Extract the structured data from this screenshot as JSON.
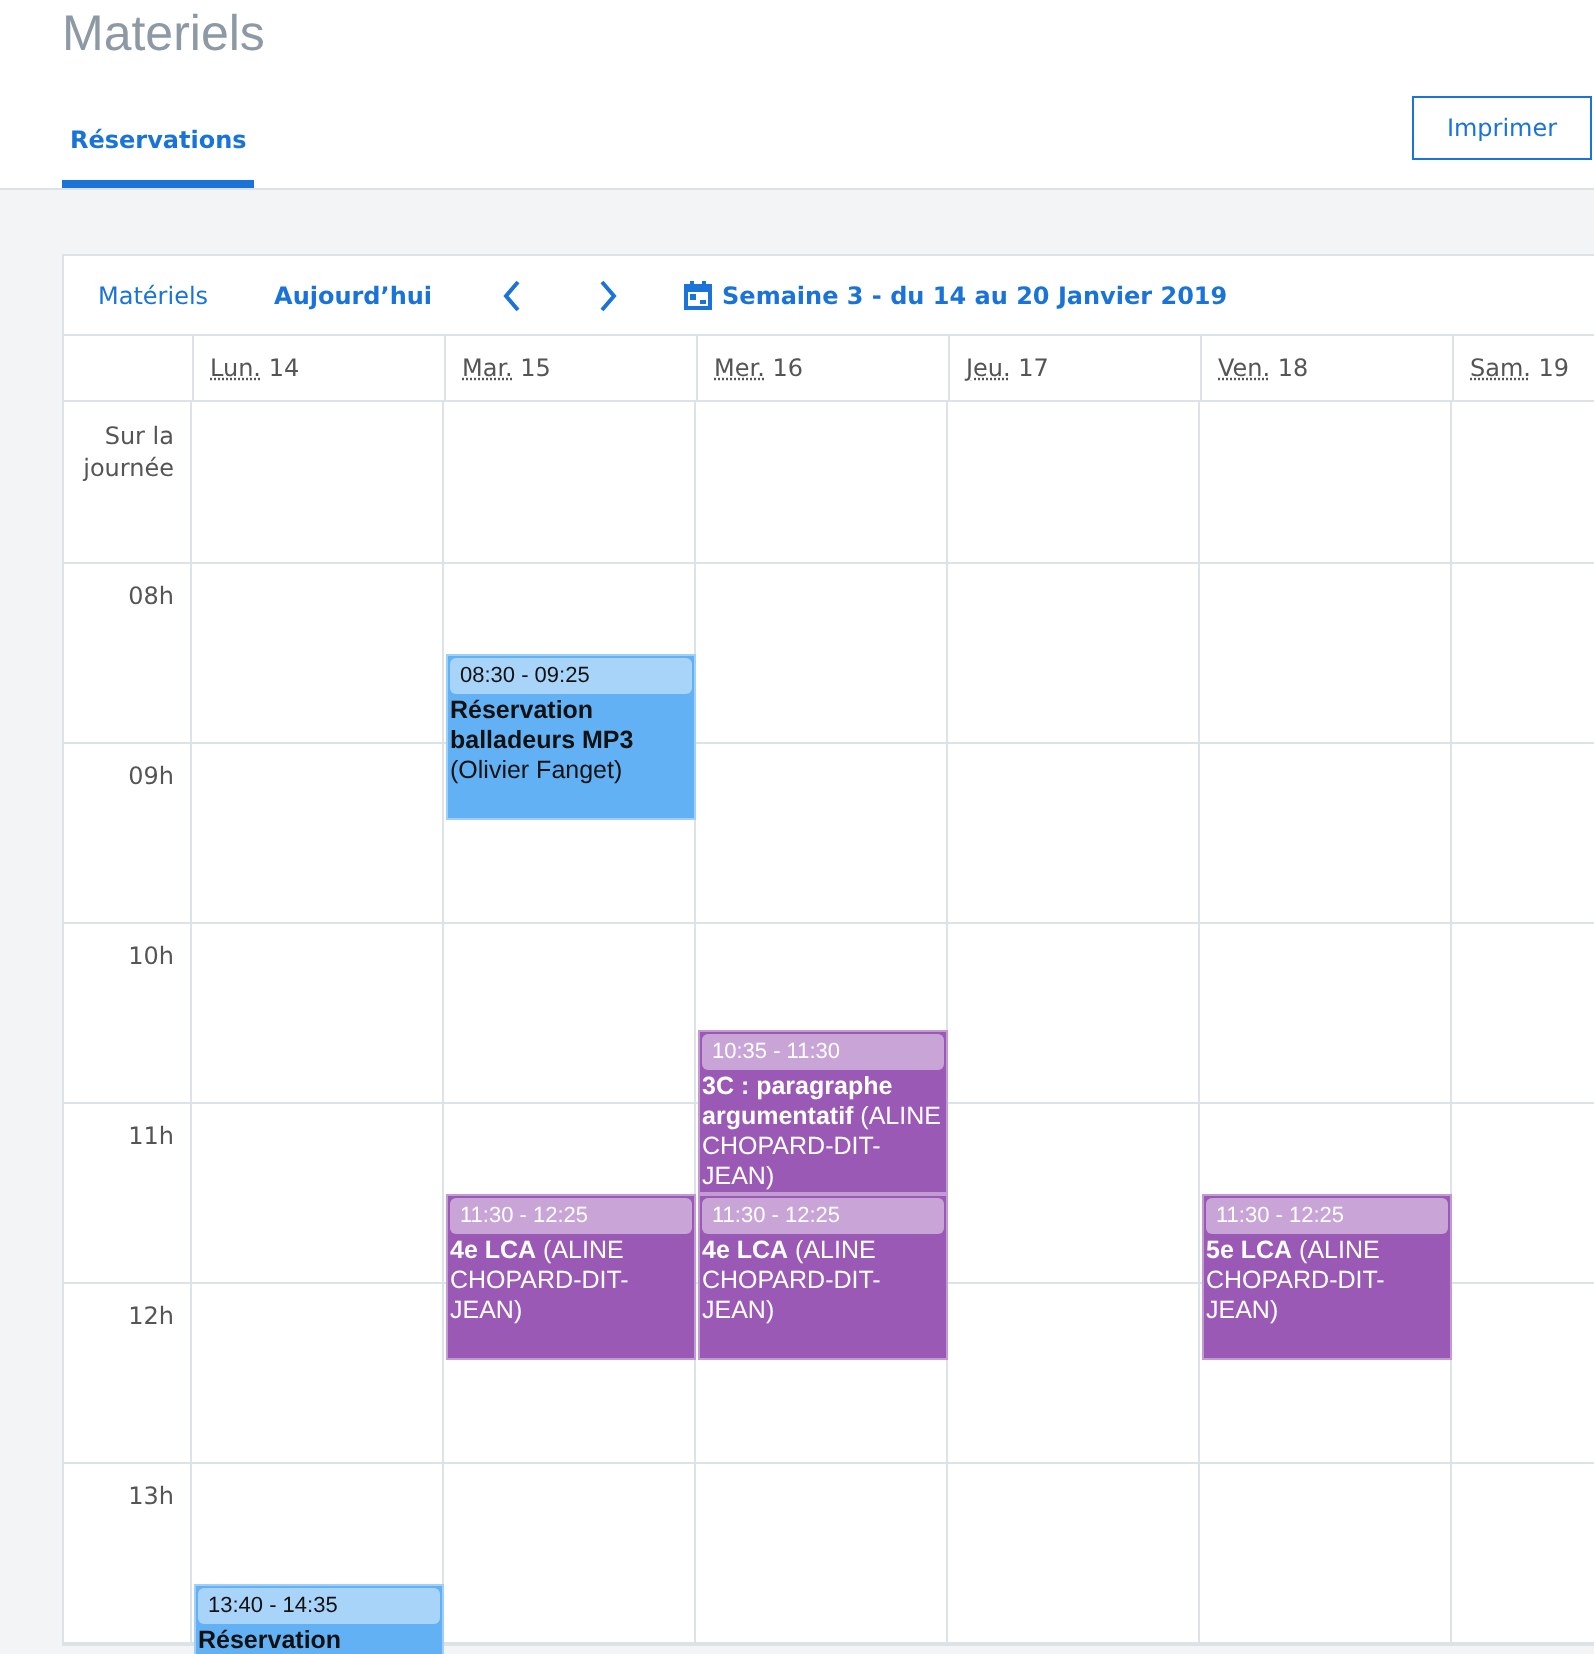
{
  "page_title": "Materiels",
  "tabs": [
    {
      "label": "Réservations",
      "selected": true
    }
  ],
  "print_button": "Imprimer",
  "toolbar": {
    "resources_link": "Matériels",
    "today_button": "Aujourd’hui",
    "week_label": "Semaine 3 - du 14 au 20 Janvier 2019"
  },
  "all_day_label": "Sur la journée",
  "hours": [
    "08h",
    "09h",
    "10h",
    "11h",
    "12h",
    "13h"
  ],
  "days": [
    {
      "abbr": "Lun.",
      "day": "14",
      "events": [
        {
          "time": "13:40 - 14:35",
          "title": "Réservation",
          "color": "#62b1f5"
        }
      ]
    },
    {
      "abbr": "Mar.",
      "day": "15",
      "events": [
        {
          "time": "08:30 - 09:25",
          "title": "Réservation balladeurs MP3",
          "detail": "(Olivier Fanget)",
          "color": "#62b1f5"
        },
        {
          "time": "11:30 - 12:25",
          "title": "4e LCA",
          "detail": "(ALINE CHOPARD-DIT-JEAN)",
          "color": "#9b59b6"
        }
      ]
    },
    {
      "abbr": "Mer.",
      "day": "16",
      "events": [
        {
          "time": "10:35 - 11:30",
          "title": "3C : paragraphe argumentatif",
          "detail": "(ALINE CHOPARD-DIT-JEAN)",
          "color": "#9b59b6"
        },
        {
          "time": "11:30 - 12:25",
          "title": "4e LCA",
          "detail": "(ALINE CHOPARD-DIT-JEAN)",
          "color": "#9b59b6"
        }
      ]
    },
    {
      "abbr": "Jeu.",
      "day": "17"
    },
    {
      "abbr": "Ven.",
      "day": "18",
      "events": [
        {
          "time": "11:30 - 12:25",
          "title": "5e LCA",
          "detail": "(ALINE CHOPARD-DIT-JEAN)",
          "color": "#9b59b6"
        }
      ]
    },
    {
      "abbr": "Sam.",
      "day": "19"
    }
  ]
}
